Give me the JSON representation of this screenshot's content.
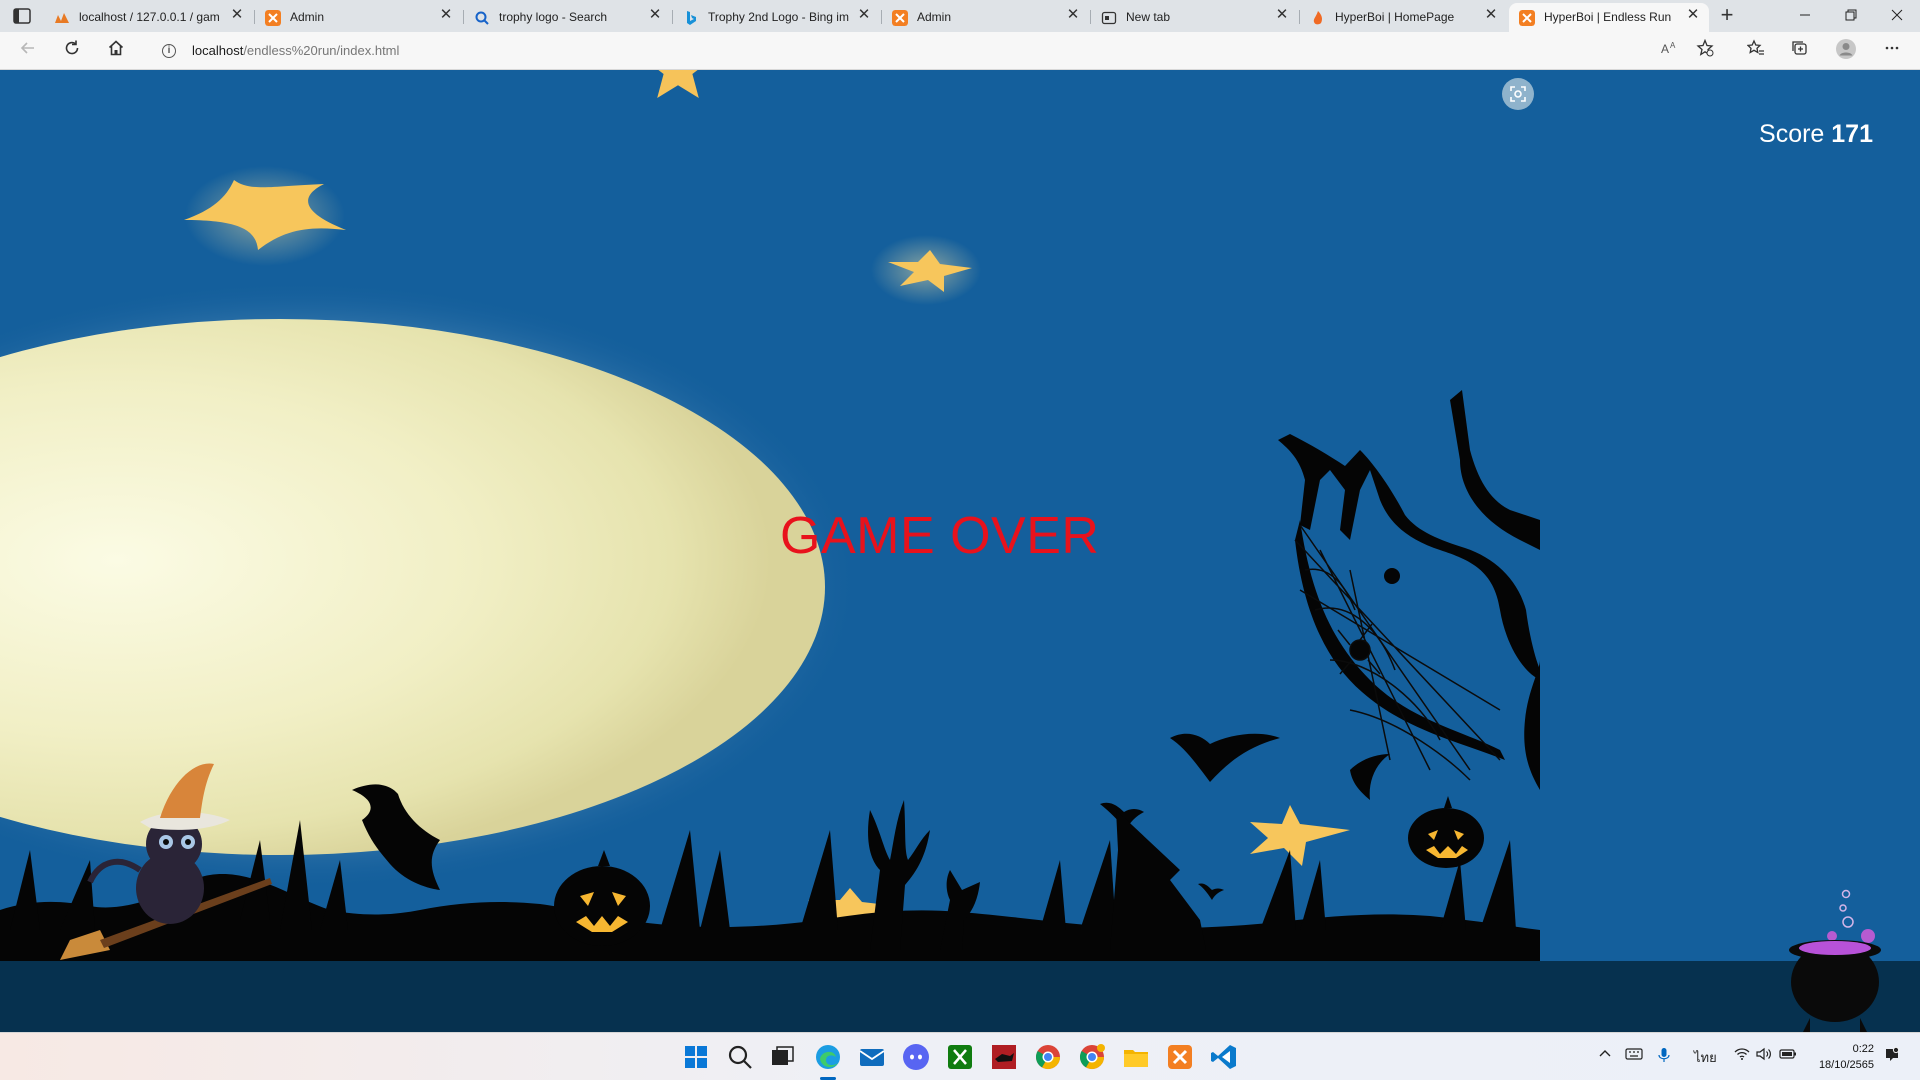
{
  "browser": {
    "tabs": [
      {
        "title": "localhost / 127.0.0.1 / gam",
        "favicon": "phpmyadmin-icon",
        "active": false
      },
      {
        "title": "Admin",
        "favicon": "xampp-icon",
        "active": false
      },
      {
        "title": "trophy logo - Search",
        "favicon": "search-icon",
        "active": false
      },
      {
        "title": "Trophy 2nd Logo - Bing im",
        "favicon": "bing-icon",
        "active": false
      },
      {
        "title": "Admin",
        "favicon": "xampp-icon",
        "active": false
      },
      {
        "title": "New tab",
        "favicon": "newtab-icon",
        "active": false
      },
      {
        "title": "HyperBoi | HomePage",
        "favicon": "hyperboi-icon",
        "active": false
      },
      {
        "title": "HyperBoi | Endless Run",
        "favicon": "xampp-icon",
        "active": true
      }
    ],
    "tab_close_glyph": "✕",
    "new_tab_glyph": "+",
    "url_host": "localhost",
    "url_path": "/endless%20run/index.html"
  },
  "game": {
    "score_label": "Score",
    "score_value": "171",
    "status_text": "GAME OVER",
    "colors": {
      "sky": "#145f9c",
      "moon": "#f4f3d2",
      "game_over": "#e8121c",
      "ground": "#06314f"
    }
  },
  "taskbar": {
    "tray_language": "ไทย",
    "time": "0:22",
    "date": "18/10/2565"
  }
}
